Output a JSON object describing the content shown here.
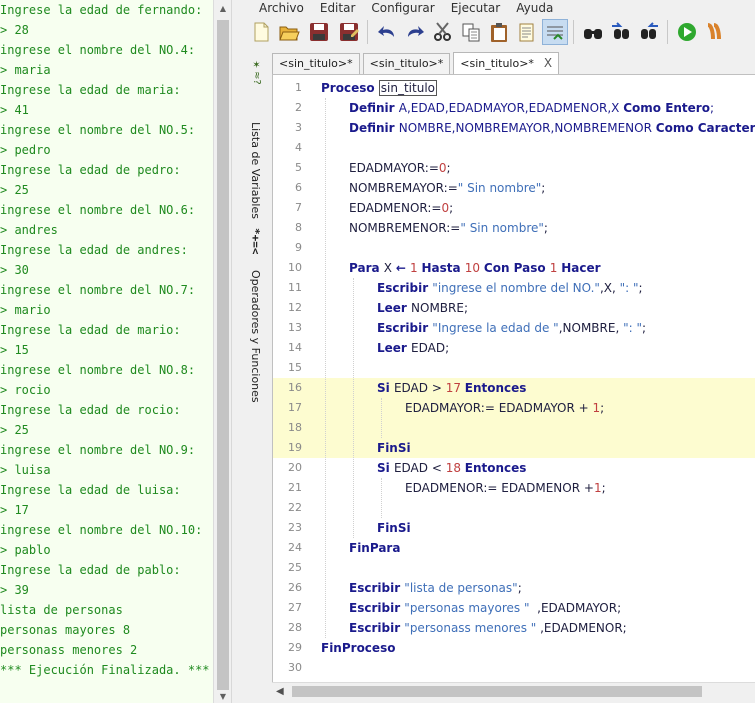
{
  "menu": [
    "Archivo",
    "Editar",
    "Configurar",
    "Ejecutar",
    "Ayuda"
  ],
  "console": [
    "Ingrese la edad de fernando:",
    "> 28",
    "ingrese el nombre del NO.4:",
    "> maria",
    "Ingrese la edad de maria:",
    "> 41",
    "ingrese el nombre del NO.5:",
    "> pedro",
    "Ingrese la edad de pedro:",
    "> 25",
    "ingrese el nombre del NO.6:",
    "> andres",
    "Ingrese la edad de andres:",
    "> 30",
    "ingrese el nombre del NO.7:",
    "> mario",
    "Ingrese la edad de mario:",
    "> 15",
    "ingrese el nombre del NO.8:",
    "> rocio",
    "Ingrese la edad de rocio:",
    "> 25",
    "ingrese el nombre del NO.9:",
    "> luisa",
    "Ingrese la edad de luisa:",
    "> 17",
    "ingrese el nombre del NO.10:",
    "> pablo",
    "Ingrese la edad de pablo:",
    "> 39",
    "lista de personas",
    "personas mayores 8",
    "personass menores 2",
    "*** Ejecución Finalizada. ***"
  ],
  "side_panel": {
    "variables_label": "Lista de Variables",
    "operators_symbol": "*+=<",
    "operators_label": "Operadores y Funciones"
  },
  "tabs": [
    {
      "label": "<sin_titulo>*",
      "active": false
    },
    {
      "label": "<sin_titulo>*",
      "active": false
    },
    {
      "label": "<sin_titulo>*",
      "active": true,
      "close": "X"
    }
  ],
  "toolbar_icons": [
    "new-icon",
    "open-icon",
    "save-icon",
    "save-as-icon",
    "undo-icon",
    "redo-icon",
    "cut-icon",
    "copy-icon",
    "paste-icon",
    "edit-icon",
    "indent-icon",
    "debug-watch-icon",
    "find-icon",
    "find-prev-icon",
    "find-next-icon",
    "run-icon",
    "step-icon"
  ],
  "code": {
    "highlight_lines": [
      16,
      17,
      18,
      19
    ],
    "lines": [
      {
        "n": "1",
        "indent": 0,
        "t": [
          [
            "kw",
            "Proceso "
          ],
          [
            "box",
            "sin_titulo"
          ]
        ]
      },
      {
        "n": "2",
        "indent": 1,
        "t": [
          [
            "kw",
            "Definir "
          ],
          [
            "var",
            "A,EDAD,EDADMAYOR,EDADMENOR,X "
          ],
          [
            "kw",
            "Como Entero"
          ],
          [
            "var",
            ";"
          ]
        ]
      },
      {
        "n": "3",
        "indent": 1,
        "t": [
          [
            "kw",
            "Definir "
          ],
          [
            "var",
            "NOMBRE,NOMBREMAYOR,NOMBREMENOR "
          ],
          [
            "kw",
            "Como Caracter"
          ],
          [
            "var",
            ";"
          ]
        ]
      },
      {
        "n": "4",
        "indent": 0,
        "t": []
      },
      {
        "n": "5",
        "indent": 1,
        "t": [
          [
            "plain",
            "EDADMAYOR:="
          ],
          [
            "num",
            "0"
          ],
          [
            "plain",
            ";"
          ]
        ]
      },
      {
        "n": "6",
        "indent": 1,
        "t": [
          [
            "plain",
            "NOMBREMAYOR:="
          ],
          [
            "str",
            "\" Sin nombre\""
          ],
          [
            "plain",
            ";"
          ]
        ]
      },
      {
        "n": "7",
        "indent": 1,
        "t": [
          [
            "plain",
            "EDADMENOR:="
          ],
          [
            "num",
            "0"
          ],
          [
            "plain",
            ";"
          ]
        ]
      },
      {
        "n": "8",
        "indent": 1,
        "t": [
          [
            "plain",
            "NOMBREMENOR:="
          ],
          [
            "str",
            "\" Sin nombre\""
          ],
          [
            "plain",
            ";"
          ]
        ]
      },
      {
        "n": "9",
        "indent": 0,
        "t": []
      },
      {
        "n": "10",
        "indent": 1,
        "t": [
          [
            "kw",
            "Para "
          ],
          [
            "plain",
            "X "
          ],
          [
            "kw",
            "← "
          ],
          [
            "num",
            "1 "
          ],
          [
            "kw",
            "Hasta "
          ],
          [
            "num",
            "10 "
          ],
          [
            "kw",
            "Con Paso "
          ],
          [
            "num",
            "1 "
          ],
          [
            "kw",
            "Hacer"
          ]
        ]
      },
      {
        "n": "11",
        "indent": 2,
        "t": [
          [
            "kw",
            "Escribir "
          ],
          [
            "str",
            "\"ingrese el nombre del NO.\""
          ],
          [
            "plain",
            ",X, "
          ],
          [
            "str",
            "\": \""
          ],
          [
            "plain",
            ";"
          ]
        ]
      },
      {
        "n": "12",
        "indent": 2,
        "t": [
          [
            "kw",
            "Leer "
          ],
          [
            "plain",
            "NOMBRE;"
          ]
        ]
      },
      {
        "n": "13",
        "indent": 2,
        "t": [
          [
            "kw",
            "Escribir "
          ],
          [
            "str",
            "\"Ingrese la edad de \""
          ],
          [
            "plain",
            ",NOMBRE, "
          ],
          [
            "str",
            "\": \""
          ],
          [
            "plain",
            ";"
          ]
        ]
      },
      {
        "n": "14",
        "indent": 2,
        "t": [
          [
            "kw",
            "Leer "
          ],
          [
            "plain",
            "EDAD;"
          ]
        ]
      },
      {
        "n": "15",
        "indent": 0,
        "t": []
      },
      {
        "n": "16",
        "indent": 2,
        "t": [
          [
            "kw",
            "Si "
          ],
          [
            "plain",
            "EDAD > "
          ],
          [
            "num",
            "17 "
          ],
          [
            "kw",
            "Entonces"
          ]
        ]
      },
      {
        "n": "17",
        "indent": 3,
        "t": [
          [
            "plain",
            "EDADMAYOR:= EDADMAYOR + "
          ],
          [
            "num",
            "1"
          ],
          [
            "plain",
            ";"
          ]
        ]
      },
      {
        "n": "18",
        "indent": 0,
        "t": []
      },
      {
        "n": "19",
        "indent": 2,
        "t": [
          [
            "kw",
            "FinSi"
          ]
        ]
      },
      {
        "n": "20",
        "indent": 2,
        "t": [
          [
            "kw",
            "Si "
          ],
          [
            "plain",
            "EDAD < "
          ],
          [
            "num",
            "18 "
          ],
          [
            "kw",
            "Entonces"
          ]
        ]
      },
      {
        "n": "21",
        "indent": 3,
        "t": [
          [
            "plain",
            "EDADMENOR:= EDADMENOR +"
          ],
          [
            "num",
            "1"
          ],
          [
            "plain",
            ";"
          ]
        ]
      },
      {
        "n": "22",
        "indent": 0,
        "t": []
      },
      {
        "n": "23",
        "indent": 2,
        "t": [
          [
            "kw",
            "FinSi"
          ]
        ]
      },
      {
        "n": "24",
        "indent": 1,
        "t": [
          [
            "kw",
            "FinPara"
          ]
        ]
      },
      {
        "n": "25",
        "indent": 0,
        "t": []
      },
      {
        "n": "26",
        "indent": 1,
        "t": [
          [
            "kw",
            "Escribir "
          ],
          [
            "str",
            "\"lista de personas\""
          ],
          [
            "plain",
            ";"
          ]
        ]
      },
      {
        "n": "27",
        "indent": 1,
        "t": [
          [
            "kw",
            "Escribir "
          ],
          [
            "str",
            "\"personas mayores \""
          ],
          [
            "plain",
            "  ,EDADMAYOR;"
          ]
        ]
      },
      {
        "n": "28",
        "indent": 1,
        "t": [
          [
            "kw",
            "Escribir "
          ],
          [
            "str",
            "\"personass menores \""
          ],
          [
            "plain",
            " ,EDADMENOR;"
          ]
        ]
      },
      {
        "n": "29",
        "indent": 0,
        "t": [
          [
            "kw",
            "FinProceso"
          ]
        ]
      },
      {
        "n": "30",
        "indent": 0,
        "t": []
      }
    ]
  },
  "colors": {
    "console_text": "#1f8a1f",
    "keyword": "#1a1a8c",
    "string": "#3f6fb8",
    "number": "#c04040",
    "highlight": "#fdfcd0"
  }
}
